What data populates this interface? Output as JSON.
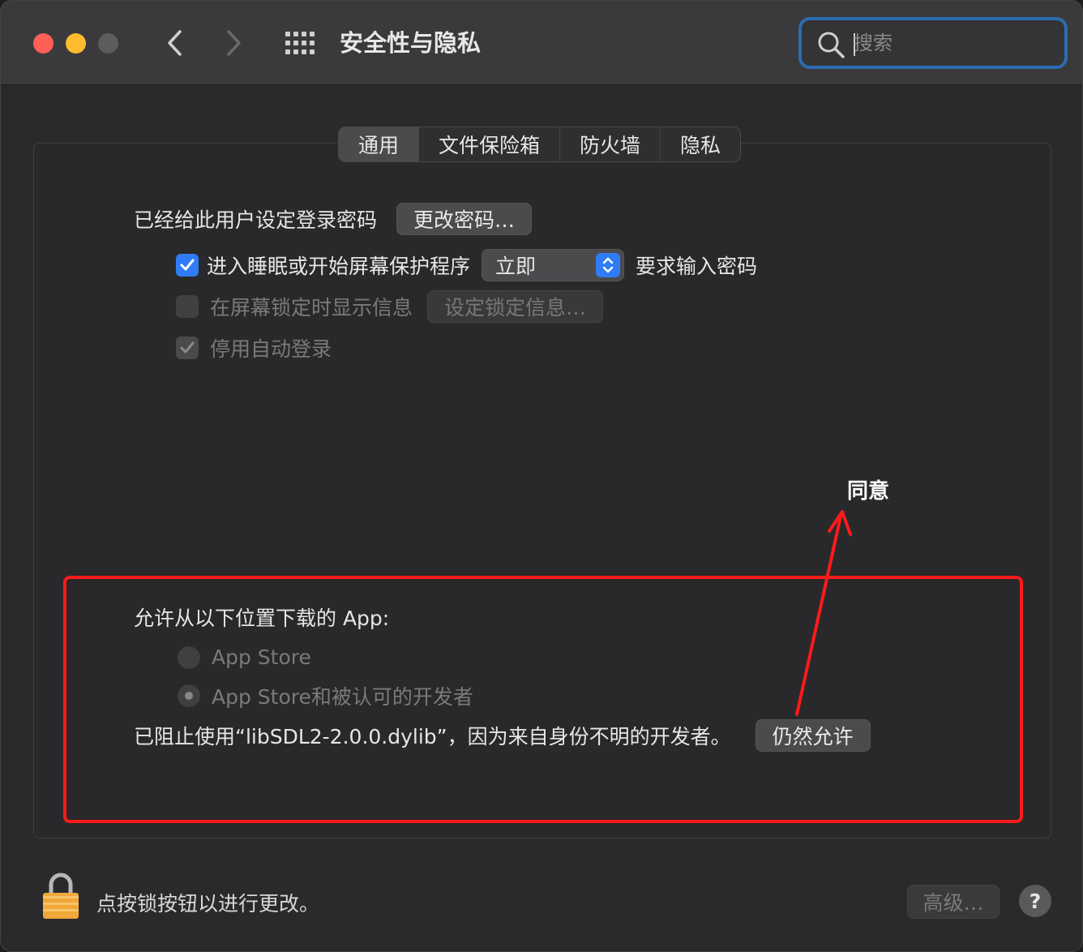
{
  "window": {
    "title": "安全性与隐私",
    "search_placeholder": "搜索"
  },
  "tabs": [
    {
      "label": "通用",
      "active": true
    },
    {
      "label": "文件保险箱",
      "active": false
    },
    {
      "label": "防火墙",
      "active": false
    },
    {
      "label": "隐私",
      "active": false
    }
  ],
  "general": {
    "password_set_label": "已经给此用户设定登录密码",
    "change_password_button": "更改密码…",
    "require_password": {
      "label": "进入睡眠或开始屏幕保护程序",
      "checked": true,
      "select_value": "立即",
      "suffix": "要求输入密码"
    },
    "show_message": {
      "label": "在屏幕锁定时显示信息",
      "checked": false,
      "button": "设定锁定信息…"
    },
    "disable_auto_login": {
      "label": "停用自动登录",
      "checked": true
    }
  },
  "downloads": {
    "heading": "允许从以下位置下载的 App:",
    "options": [
      {
        "label": "App Store",
        "selected": false
      },
      {
        "label": "App Store和被认可的开发者",
        "selected": true
      }
    ],
    "blocked_message": "已阻止使用“libSDL2-2.0.0.dylib”，因为来自身份不明的开发者。",
    "allow_button": "仍然允许"
  },
  "annotation": {
    "text": "同意",
    "color": "#ff1a1a"
  },
  "footer": {
    "lock_text": "点按锁按钮以进行更改。",
    "advanced_button": "高级…",
    "help_button": "?"
  },
  "colors": {
    "accent": "#2f7cf6",
    "highlight": "#ff1a1a"
  }
}
